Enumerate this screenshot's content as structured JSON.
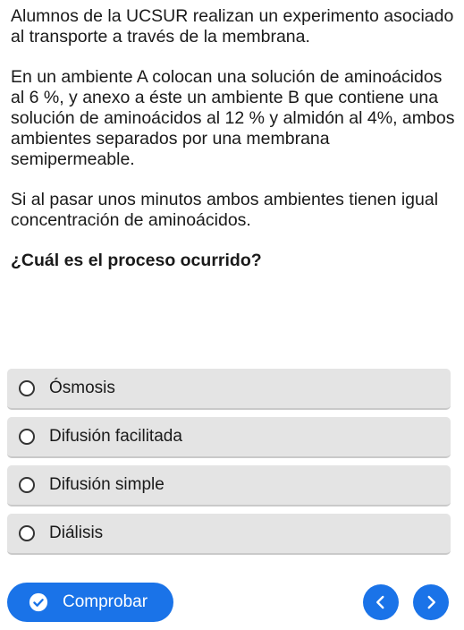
{
  "question": {
    "paragraph1": "Alumnos de la UCSUR realizan un experimento asociado al transporte a través de la membrana.",
    "paragraph2": "En un ambiente A colocan una solución de aminoácidos al 6 %, y anexo a éste un ambiente B que contiene una solución de aminoácidos al 12 % y almidón al 4%, ambos ambientes separados por una membrana semipermeable.",
    "paragraph3": "Si al pasar unos minutos ambos ambientes tienen igual concentración de aminoácidos.",
    "ask": "¿Cuál es el proceso ocurrido?"
  },
  "options": [
    {
      "label": "Ósmosis"
    },
    {
      "label": "Difusión facilitada"
    },
    {
      "label": "Difusión simple"
    },
    {
      "label": "Diálisis"
    }
  ],
  "footer": {
    "check_label": "Comprobar",
    "check_icon": "check-circle-icon",
    "prev_icon": "chevron-left-icon",
    "next_icon": "chevron-right-icon"
  },
  "colors": {
    "accent": "#1a73e8",
    "option_bg": "#e4e4e4"
  }
}
